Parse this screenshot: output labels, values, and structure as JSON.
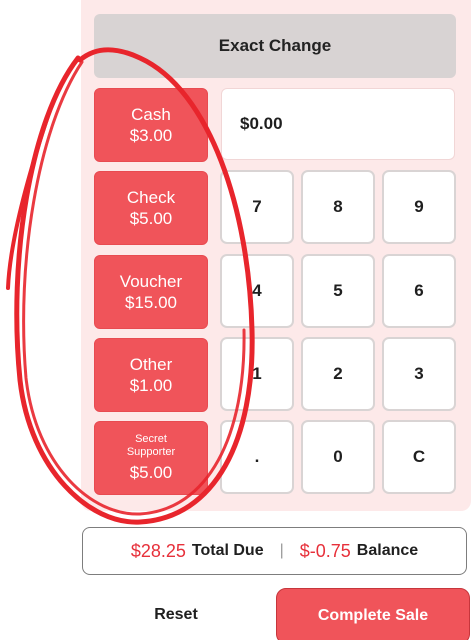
{
  "exact_change": "Exact Change",
  "payment_methods": [
    {
      "label": "Cash",
      "amount": "$3.00"
    },
    {
      "label": "Check",
      "amount": "$5.00"
    },
    {
      "label": "Voucher",
      "amount": "$15.00"
    },
    {
      "label": "Other",
      "amount": "$1.00"
    },
    {
      "label": "Secret\nSupporter",
      "amount": "$5.00"
    }
  ],
  "amount_display": "$0.00",
  "keypad": [
    "7",
    "8",
    "9",
    "4",
    "5",
    "6",
    "1",
    "2",
    "3",
    ".",
    "0",
    "C"
  ],
  "summary": {
    "total_due_amount": "$28.25",
    "total_due_label": "Total Due",
    "separator": "|",
    "balance_amount": "$-0.75",
    "balance_label": "Balance"
  },
  "actions": {
    "reset_label": "Reset",
    "complete_label": "Complete Sale"
  },
  "colors": {
    "accent": "#f0545a",
    "panel": "#fde9e9",
    "annotation": "#e8252c"
  }
}
